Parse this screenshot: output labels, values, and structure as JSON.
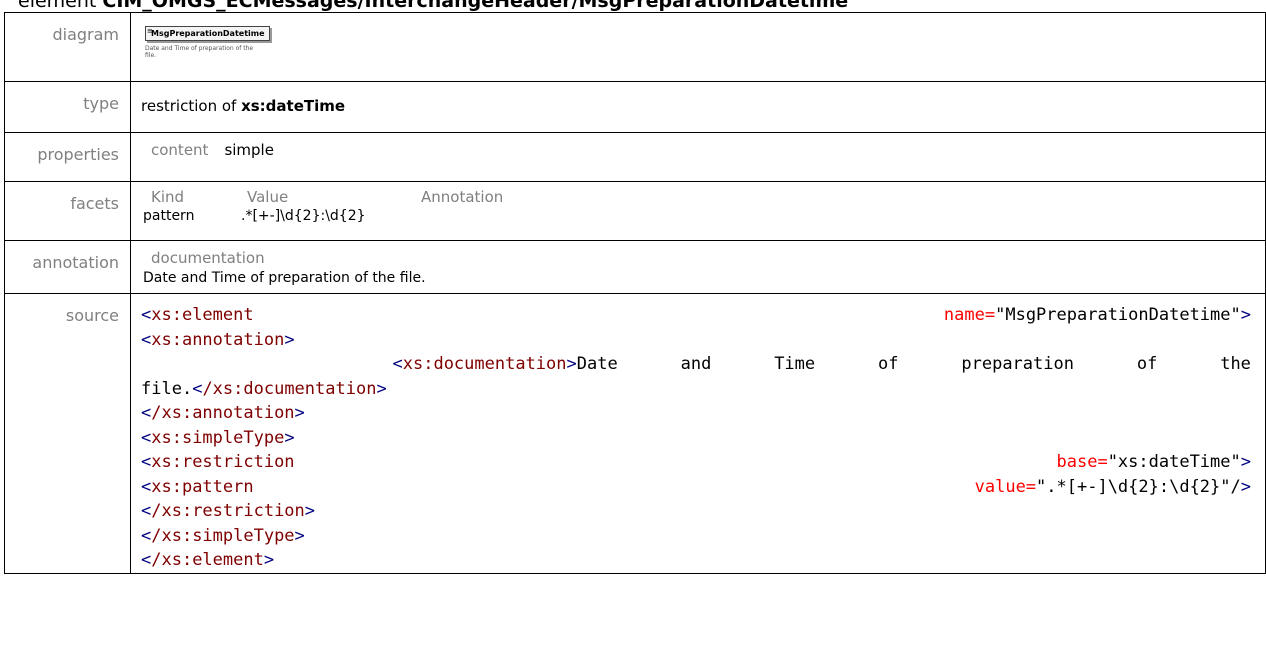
{
  "heading": {
    "prefix": "element ",
    "name": "CIM_OMGS_ECMessages/InterchangeHeader/MsgPreparationDatetime"
  },
  "diagram": {
    "label": "diagram",
    "box_label": "MsgPreparationDatetime",
    "box_doc": "Date and Time of preparation of the file."
  },
  "type": {
    "label": "type",
    "prefix": "restriction of ",
    "base": "xs:dateTime"
  },
  "properties": {
    "label": "properties",
    "key": "content",
    "value": "simple"
  },
  "facets": {
    "label": "facets",
    "headers": [
      "Kind",
      "Value",
      "Annotation"
    ],
    "rows": [
      {
        "kind": "pattern",
        "value": ".*[+-]\\d{2}:\\d{2}",
        "annotation": ""
      }
    ]
  },
  "annotation": {
    "label": "annotation",
    "header": "documentation",
    "text": "Date and Time of preparation of the file."
  },
  "source": {
    "label": "source",
    "lines": [
      [
        "xs:element",
        "name=",
        "\"MsgPreparationDatetime\""
      ],
      [
        "xs:annotation"
      ],
      [
        "xs:documentation",
        "Date and Time of preparation of the",
        "file.",
        "/xs:documentation"
      ],
      [
        "/xs:annotation"
      ],
      [
        "xs:simpleType"
      ],
      [
        "xs:restriction",
        "base=",
        "\"xs:dateTime\""
      ],
      [
        "xs:pattern",
        "value=",
        "\".*[+-]\\d{2}:\\d{2}\"/"
      ],
      [
        "/xs:restriction"
      ],
      [
        "/xs:simpleType"
      ],
      [
        "/xs:element"
      ]
    ]
  }
}
